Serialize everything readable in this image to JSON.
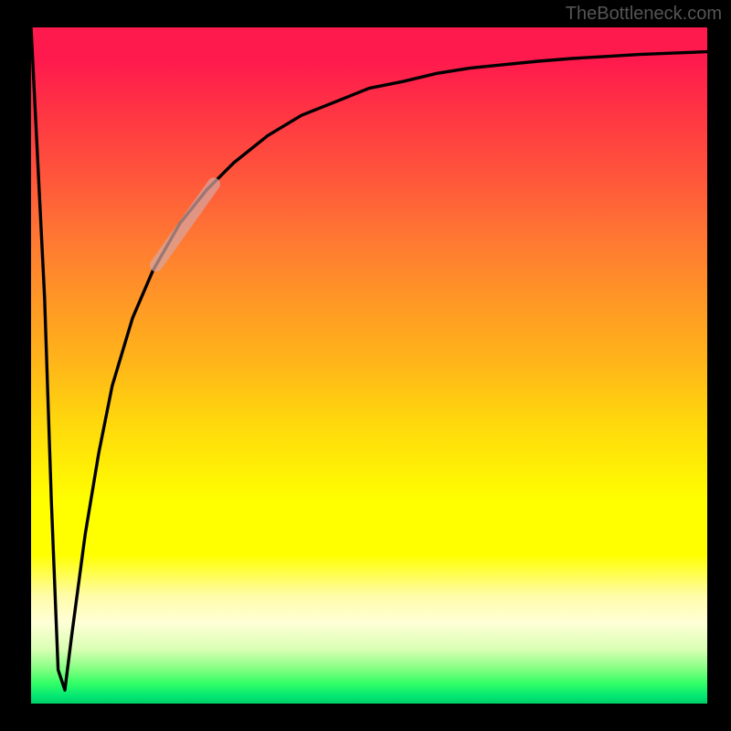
{
  "watermark": "TheBottleneck.com",
  "chart_data": {
    "type": "line",
    "title": "",
    "xlabel": "",
    "ylabel": "",
    "xlim": [
      0,
      100
    ],
    "ylim": [
      0,
      100
    ],
    "grid": false,
    "legend": false,
    "series": [
      {
        "name": "curve",
        "x": [
          0,
          2,
          3,
          4,
          5,
          6,
          8,
          10,
          12,
          15,
          18,
          22,
          26,
          30,
          35,
          40,
          45,
          50,
          55,
          60,
          65,
          70,
          75,
          80,
          85,
          90,
          95,
          100
        ],
        "values": [
          100,
          60,
          30,
          5,
          2,
          10,
          25,
          37,
          47,
          57,
          64,
          71,
          76,
          80,
          84,
          87,
          89,
          91,
          92,
          93.2,
          94,
          94.5,
          95,
          95.4,
          95.7,
          96,
          96.2,
          96.4
        ]
      }
    ],
    "highlight_segment": {
      "x_range": [
        17.9,
        27.5
      ],
      "y_range": [
        64,
        77.5
      ]
    },
    "gradient_stops": [
      {
        "pos": 0.0,
        "color": "#ff1a4d"
      },
      {
        "pos": 0.3,
        "color": "#ff7733"
      },
      {
        "pos": 0.55,
        "color": "#ffd60d"
      },
      {
        "pos": 0.78,
        "color": "#ffff00"
      },
      {
        "pos": 0.9,
        "color": "#d9ffb3"
      },
      {
        "pos": 1.0,
        "color": "#00cc66"
      }
    ]
  }
}
